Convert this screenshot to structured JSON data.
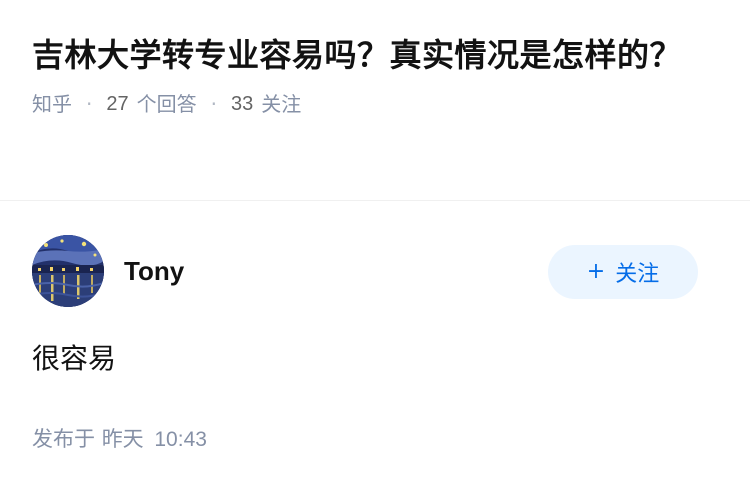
{
  "question": {
    "title": "吉林大学转专业容易吗？真实情况是怎样的？",
    "source": "知乎",
    "answers_count": "27",
    "answers_label": "个回答",
    "follow_count": "33",
    "follow_label": "关注"
  },
  "answer": {
    "avatar_icon": "starry-night-avatar",
    "author_name": "Tony",
    "follow_button": {
      "plus": "+",
      "label": "关注"
    },
    "content": "很容易",
    "published_prefix": "发布于",
    "published_day": "昨天",
    "published_time": "10:43"
  },
  "colors": {
    "title": "#121212",
    "meta": "#8590a6",
    "accent": "#056de8",
    "button_bg": "#ebf5ff"
  }
}
